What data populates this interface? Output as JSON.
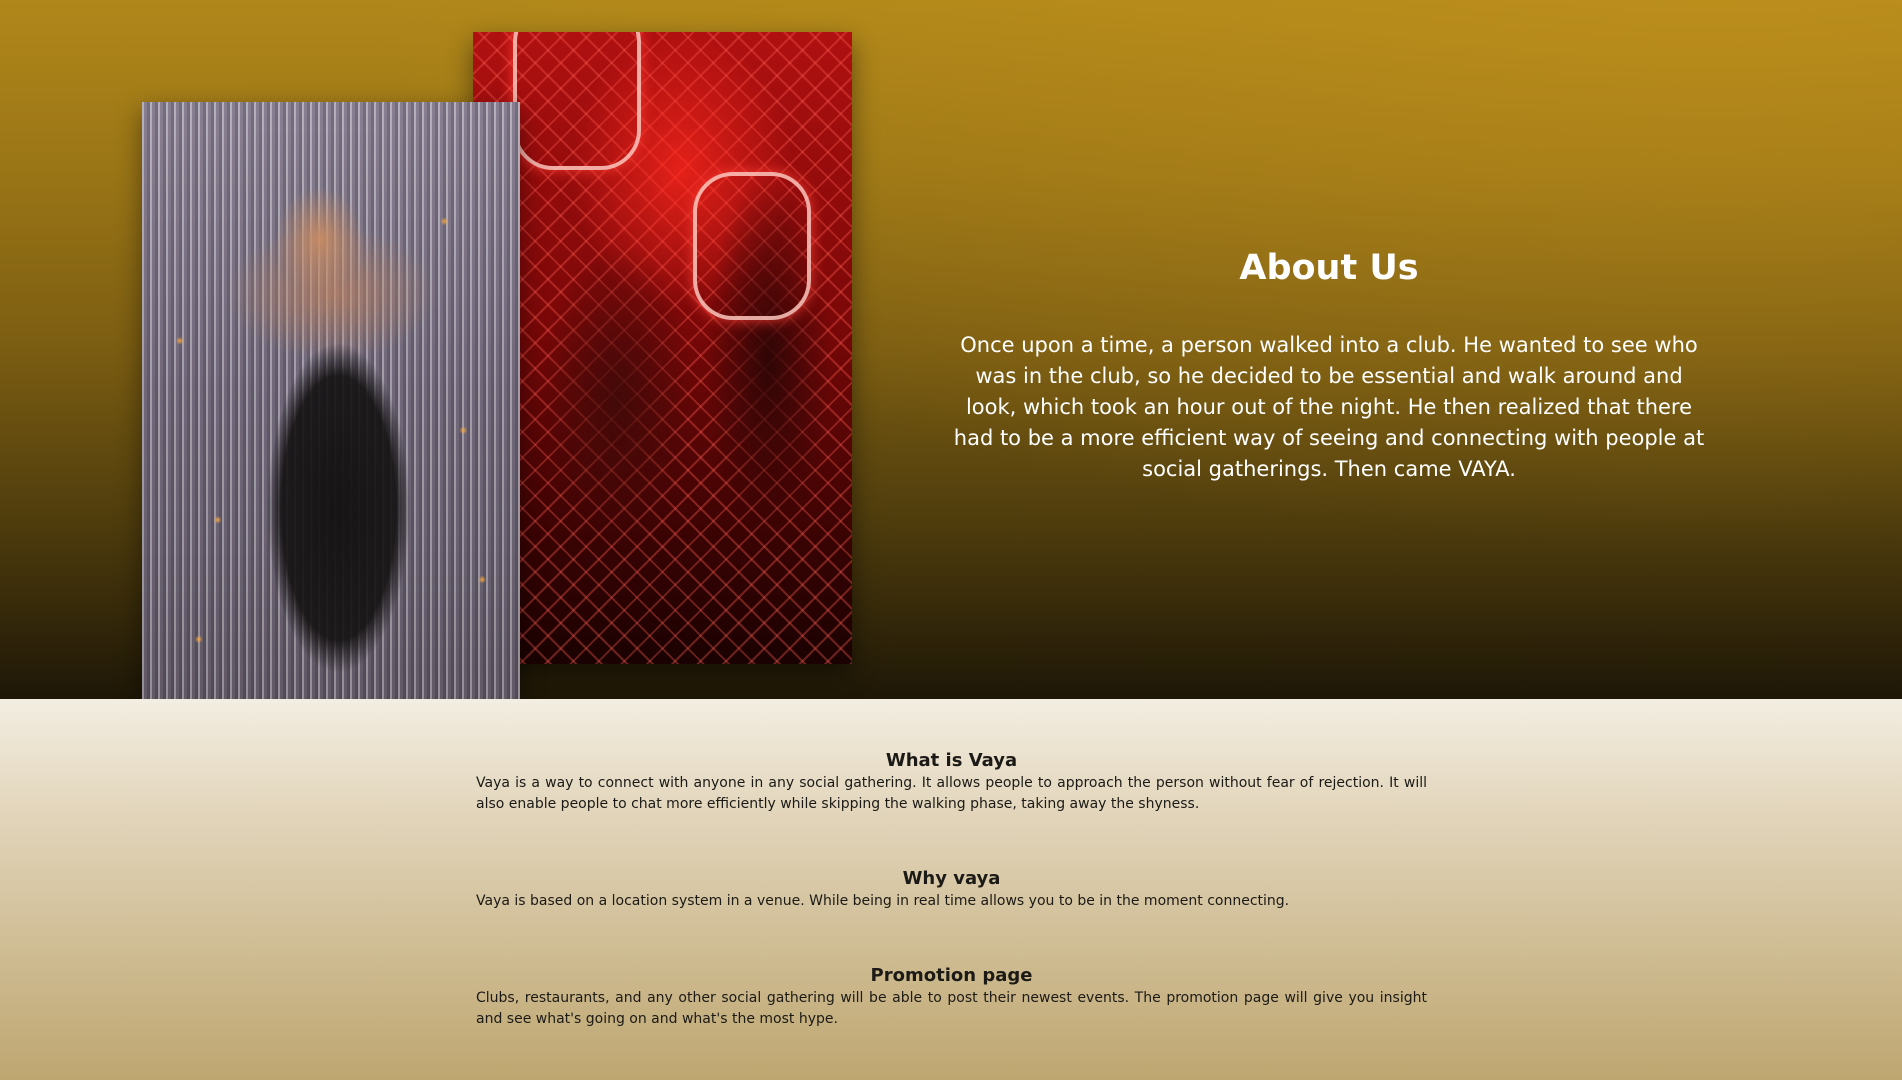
{
  "about": {
    "title": "About Us",
    "body": "Once upon a time, a person walked into a club. He wanted to see who was in the club, so he decided to be essential and walk around and look, which took an hour out of the night. He then realized that there had to be a more efficient way of seeing and connecting with people at social gatherings. Then came VAYA."
  },
  "images": {
    "left_photo": "woman-in-black-dress-photo",
    "right_photo": "club-neon-dancers-photo"
  },
  "sections": [
    {
      "heading": "What is Vaya",
      "body": "Vaya is a way to connect with anyone in any social gathering. It allows people to approach the person without fear of rejection. It will also enable people to chat more efficiently while skipping the walking phase, taking away the shyness."
    },
    {
      "heading": "Why vaya",
      "body": "Vaya is based on a location system in a venue. While being in real time allows you to be in the moment connecting."
    },
    {
      "heading": "Promotion page",
      "body": "Clubs, restaurants, and any other social gathering will be able to post their newest events. The promotion page will give you insight and see what's going on and what's the most hype."
    }
  ],
  "colors": {
    "hero_gradient_top": "#b0871a",
    "hero_gradient_bottom": "#1e1707",
    "info_gradient_top": "#f3eee2",
    "info_gradient_bottom": "#bea670",
    "hero_text": "#ffffff",
    "info_text": "#1c1a16"
  }
}
